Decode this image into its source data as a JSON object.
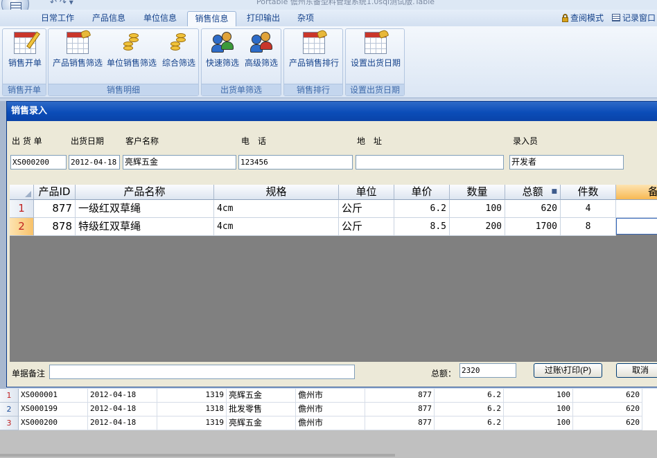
{
  "title_bar": {
    "text": "Portable    儋州东备型料管理系统1.0sql测试版.Table"
  },
  "tabs": [
    {
      "label": "日常工作"
    },
    {
      "label": "产品信息"
    },
    {
      "label": "单位信息"
    },
    {
      "label": "销售信息",
      "active": true
    },
    {
      "label": "打印输出"
    },
    {
      "label": "杂项"
    }
  ],
  "right_links": {
    "query_mode": "查阅模式",
    "record_window": "记录窗口"
  },
  "ribbon": {
    "groups": [
      {
        "caption": "销售开单",
        "buttons": [
          {
            "label": "销售开单",
            "icon": "pencil-sheet-icon"
          }
        ]
      },
      {
        "caption": "销售明细",
        "buttons": [
          {
            "label": "产品销售筛选",
            "icon": "grid-hand-icon"
          },
          {
            "label": "单位销售筛选",
            "icon": "coins-icon"
          },
          {
            "label": "综合筛选",
            "icon": "coins-icon"
          }
        ]
      },
      {
        "caption": "出货单筛选",
        "buttons": [
          {
            "label": "快速筛选",
            "icon": "people-icon"
          },
          {
            "label": "高级筛选",
            "icon": "people-icon"
          }
        ]
      },
      {
        "caption": "销售排行",
        "buttons": [
          {
            "label": "产品销售排行",
            "icon": "grid-hand-icon"
          }
        ]
      },
      {
        "caption": "设置出货日期",
        "buttons": [
          {
            "label": "设置出货日期",
            "icon": "grid-hand-icon"
          }
        ]
      }
    ]
  },
  "dialog": {
    "title": "销售录入",
    "fields": {
      "order_no": {
        "label": "出 货 单",
        "value": "XS000200"
      },
      "date": {
        "label": "出货日期",
        "value": "2012-04-18"
      },
      "customer": {
        "label": "客户名称",
        "value": "亮辉五金"
      },
      "phone": {
        "label": "电　话",
        "value": "123456"
      },
      "address": {
        "label": "地　址",
        "value": ""
      },
      "clerk": {
        "label": "录入员",
        "value": "开发者"
      }
    },
    "grid": {
      "columns": [
        "产品ID",
        "产品名称",
        "规格",
        "单位",
        "单价",
        "数量",
        "总额",
        "件数",
        "备"
      ],
      "rows": [
        {
          "n": "1",
          "id": "877",
          "name": "一级红双草绳",
          "spec": "4cm",
          "unit": "公斤",
          "price": "6.2",
          "qty": "100",
          "total": "620",
          "pieces": "4",
          "note": ""
        },
        {
          "n": "2",
          "id": "878",
          "name": "特级红双草绳",
          "spec": "4cm",
          "unit": "公斤",
          "price": "8.5",
          "qty": "200",
          "total": "1700",
          "pieces": "8",
          "note": ""
        }
      ]
    },
    "remark_label": "单据备注",
    "remark_value": "",
    "total_label": "总额：",
    "total_value": "2320",
    "post_print_button": "过账\\打印(P)",
    "cancel_button": "取消"
  },
  "background_grid": {
    "rows": [
      {
        "n": "1",
        "order": "XS000001",
        "date": "2012-04-18",
        "num": "1319",
        "customer": "亮辉五金",
        "city": "儋州市",
        "pid": "877",
        "price": "6.2",
        "qty": "100",
        "total": "620"
      },
      {
        "n": "2",
        "order": "XS000199",
        "date": "2012-04-18",
        "num": "1318",
        "customer": "批发零售",
        "city": "儋州市",
        "pid": "877",
        "price": "6.2",
        "qty": "100",
        "total": "620"
      },
      {
        "n": "3",
        "order": "XS000200",
        "date": "2012-04-18",
        "num": "1319",
        "customer": "亮辉五金",
        "city": "儋州市",
        "pid": "877",
        "price": "6.2",
        "qty": "100",
        "total": "620"
      }
    ]
  },
  "colors": {
    "ribbon_text": "#15428b",
    "dialog_title_bg": "#0b4db8",
    "row_number_red": "#c02020"
  }
}
